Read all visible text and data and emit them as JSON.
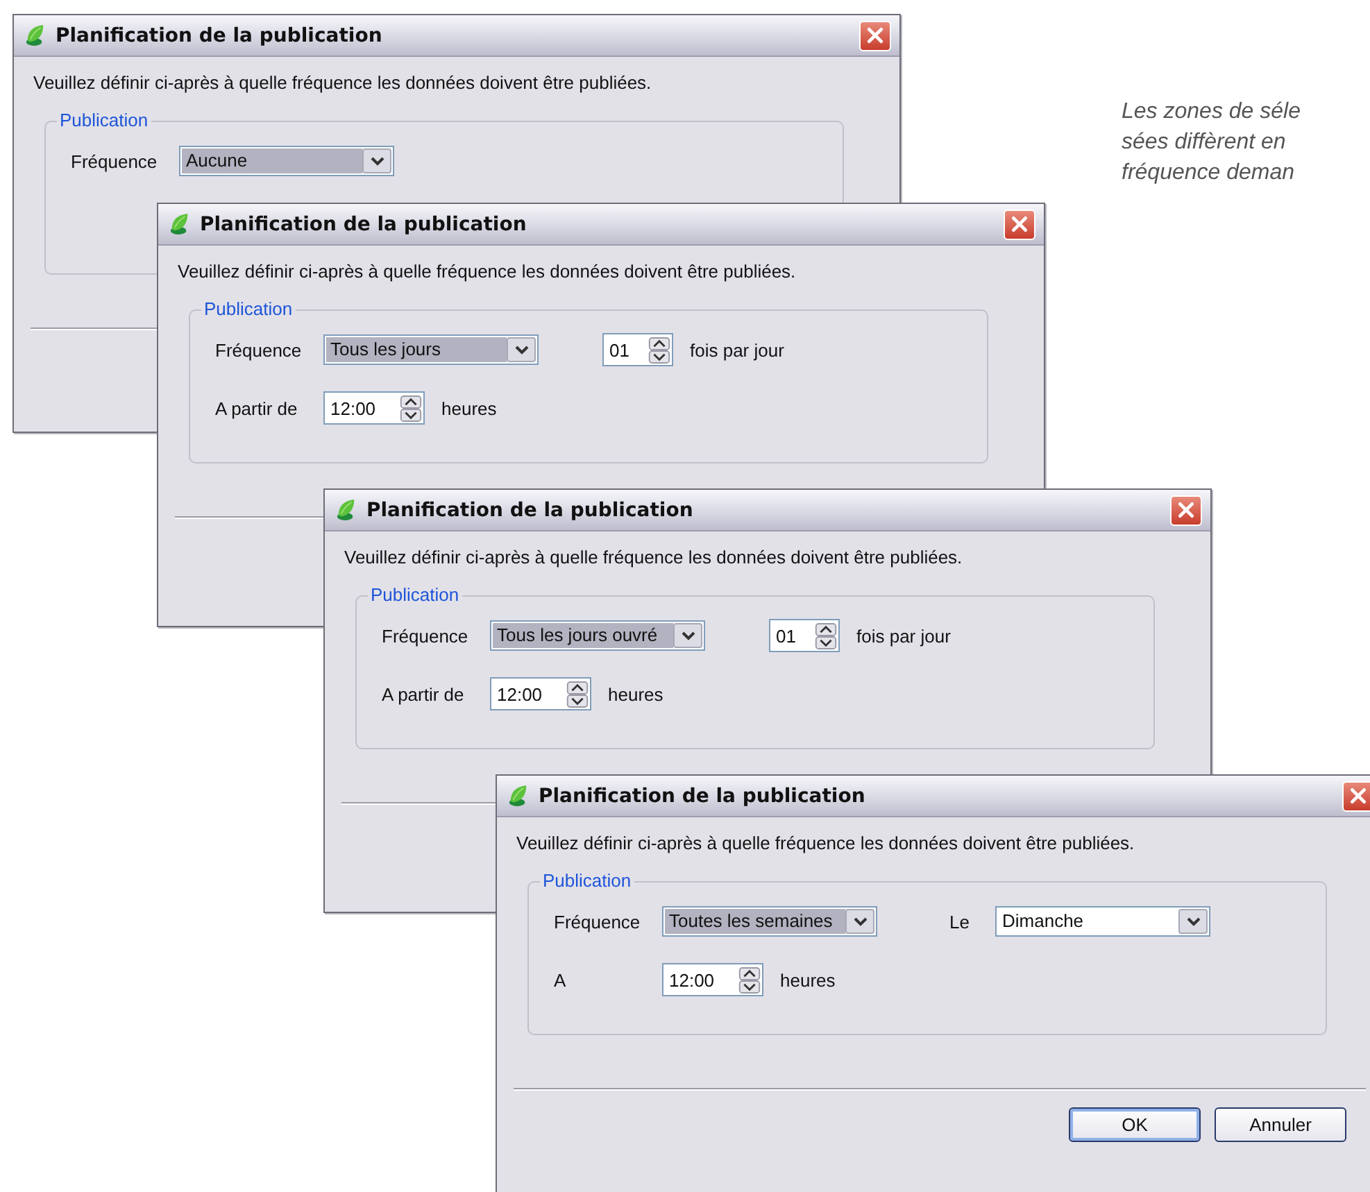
{
  "windows": [
    {
      "title": "Planification de la publication",
      "instruction": "Veuillez définir ci-après à quelle fréquence les données doivent être publiées.",
      "group": {
        "label": "Publication",
        "rows": [
          {
            "label": "Fréquence",
            "items": [
              {
                "kind": "combo",
                "value": "Aucune",
                "highlighted": true
              }
            ]
          }
        ]
      }
    },
    {
      "title": "Planification de la publication",
      "instruction": "Veuillez définir ci-après à quelle fréquence les données doivent être publiées.",
      "group": {
        "label": "Publication",
        "rows": [
          {
            "label": "Fréquence",
            "items": [
              {
                "kind": "combo",
                "value": "Tous les jours",
                "highlighted": true
              },
              {
                "kind": "spin",
                "value": "01"
              },
              {
                "kind": "text",
                "text": "fois par jour"
              }
            ]
          },
          {
            "label": "A partir de",
            "items": [
              {
                "kind": "spin",
                "value": "12:00"
              },
              {
                "kind": "text",
                "text": "heures"
              }
            ]
          }
        ]
      }
    },
    {
      "title": "Planification de la publication",
      "instruction": "Veuillez définir ci-après à quelle fréquence les données doivent être publiées.",
      "group": {
        "label": "Publication",
        "rows": [
          {
            "label": "Fréquence",
            "items": [
              {
                "kind": "combo",
                "value": "Tous les jours ouvré",
                "highlighted": true
              },
              {
                "kind": "spin",
                "value": "01"
              },
              {
                "kind": "text",
                "text": "fois par jour"
              }
            ]
          },
          {
            "label": "A partir de",
            "items": [
              {
                "kind": "spin",
                "value": "12:00"
              },
              {
                "kind": "text",
                "text": "heures"
              }
            ]
          }
        ]
      }
    },
    {
      "title": "Planification de la publication",
      "instruction": "Veuillez définir ci-après à quelle fréquence les données doivent être publiées.",
      "group": {
        "label": "Publication",
        "rows": [
          {
            "label": "Fréquence",
            "items": [
              {
                "kind": "combo",
                "value": "Toutes les semaines",
                "highlighted": true
              },
              {
                "kind": "label",
                "text": "Le"
              },
              {
                "kind": "combo",
                "value": "Dimanche",
                "highlighted": false
              }
            ]
          },
          {
            "label": "A",
            "items": [
              {
                "kind": "spin",
                "value": "12:00"
              },
              {
                "kind": "text",
                "text": "heures"
              }
            ]
          }
        ]
      },
      "buttons": [
        {
          "label": "OK",
          "default": true
        },
        {
          "label": "Annuler",
          "default": false
        }
      ]
    }
  ],
  "note": [
    "Les zones de séle",
    "sées diffèrent en",
    "fréquence deman"
  ]
}
